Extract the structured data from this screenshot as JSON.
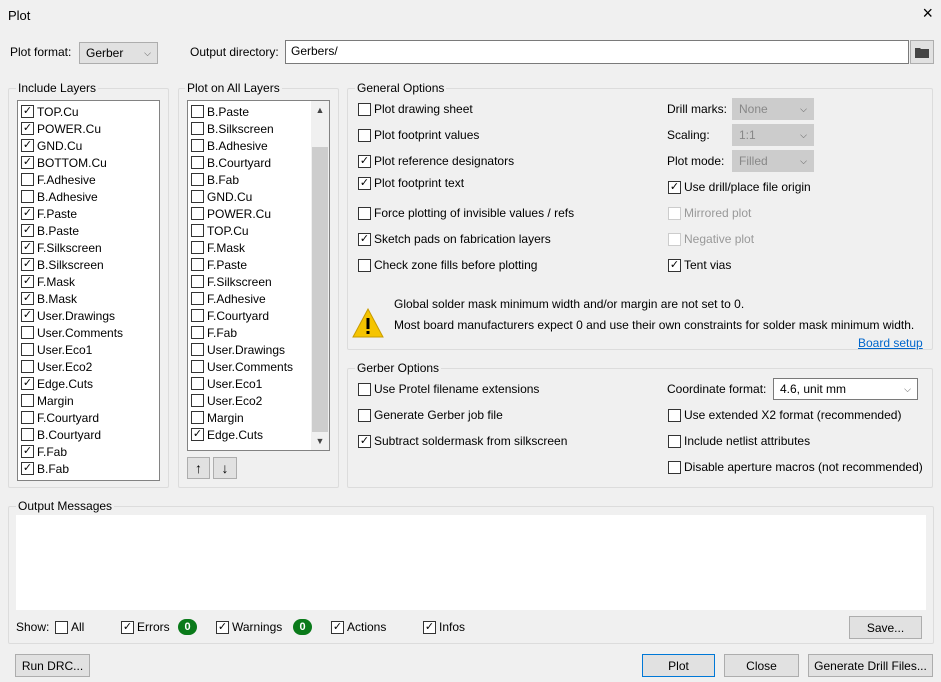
{
  "window": {
    "title": "Plot",
    "close_icon": "×"
  },
  "plot_format": {
    "label": "Plot format:",
    "value": "Gerber"
  },
  "output_dir": {
    "label": "Output directory:",
    "value": "Gerbers/",
    "folder_icon": "folder-icon"
  },
  "include_layers": {
    "title": "Include Layers",
    "items": [
      {
        "label": "TOP.Cu",
        "checked": true
      },
      {
        "label": "POWER.Cu",
        "checked": true
      },
      {
        "label": "GND.Cu",
        "checked": true
      },
      {
        "label": "BOTTOM.Cu",
        "checked": true
      },
      {
        "label": "F.Adhesive",
        "checked": false
      },
      {
        "label": "B.Adhesive",
        "checked": false
      },
      {
        "label": "F.Paste",
        "checked": true
      },
      {
        "label": "B.Paste",
        "checked": true
      },
      {
        "label": "F.Silkscreen",
        "checked": true
      },
      {
        "label": "B.Silkscreen",
        "checked": true
      },
      {
        "label": "F.Mask",
        "checked": true
      },
      {
        "label": "B.Mask",
        "checked": true
      },
      {
        "label": "User.Drawings",
        "checked": true
      },
      {
        "label": "User.Comments",
        "checked": false
      },
      {
        "label": "User.Eco1",
        "checked": false
      },
      {
        "label": "User.Eco2",
        "checked": false
      },
      {
        "label": "Edge.Cuts",
        "checked": true
      },
      {
        "label": "Margin",
        "checked": false
      },
      {
        "label": "F.Courtyard",
        "checked": false
      },
      {
        "label": "B.Courtyard",
        "checked": false
      },
      {
        "label": "F.Fab",
        "checked": true
      },
      {
        "label": "B.Fab",
        "checked": true
      }
    ]
  },
  "plot_all_layers": {
    "title": "Plot on All Layers",
    "items": [
      {
        "label": "B.Paste",
        "checked": false
      },
      {
        "label": "B.Silkscreen",
        "checked": false
      },
      {
        "label": "B.Adhesive",
        "checked": false
      },
      {
        "label": "B.Courtyard",
        "checked": false
      },
      {
        "label": "B.Fab",
        "checked": false
      },
      {
        "label": "GND.Cu",
        "checked": false
      },
      {
        "label": "POWER.Cu",
        "checked": false
      },
      {
        "label": "TOP.Cu",
        "checked": false
      },
      {
        "label": "F.Mask",
        "checked": false
      },
      {
        "label": "F.Paste",
        "checked": false
      },
      {
        "label": "F.Silkscreen",
        "checked": false
      },
      {
        "label": "F.Adhesive",
        "checked": false
      },
      {
        "label": "F.Courtyard",
        "checked": false
      },
      {
        "label": "F.Fab",
        "checked": false
      },
      {
        "label": "User.Drawings",
        "checked": false
      },
      {
        "label": "User.Comments",
        "checked": false
      },
      {
        "label": "User.Eco1",
        "checked": false
      },
      {
        "label": "User.Eco2",
        "checked": false
      },
      {
        "label": "Margin",
        "checked": false
      },
      {
        "label": "Edge.Cuts",
        "checked": true
      }
    ],
    "move_up_icon": "↑",
    "move_down_icon": "↓"
  },
  "general": {
    "title": "General Options",
    "left": [
      {
        "label": "Plot drawing sheet",
        "checked": false
      },
      {
        "label": "Plot footprint values",
        "checked": false
      },
      {
        "label": "Plot reference designators",
        "checked": true
      },
      {
        "label": "Plot footprint text",
        "checked": true
      },
      {
        "label": "Force plotting of invisible values / refs",
        "checked": false
      },
      {
        "label": "Sketch pads on fabrication layers",
        "checked": true
      },
      {
        "label": "Check zone fills before plotting",
        "checked": false
      }
    ],
    "drill_marks": {
      "label": "Drill marks:",
      "value": "None"
    },
    "scaling": {
      "label": "Scaling:",
      "value": "1:1"
    },
    "plot_mode": {
      "label": "Plot mode:",
      "value": "Filled"
    },
    "right": [
      {
        "label": "Use drill/place file origin",
        "checked": true,
        "disabled": false
      },
      {
        "label": "Mirrored plot",
        "checked": false,
        "disabled": true
      },
      {
        "label": "Negative plot",
        "checked": false,
        "disabled": true
      },
      {
        "label": "Tent vias",
        "checked": true,
        "disabled": false
      }
    ],
    "warning": {
      "line1": "Global solder mask minimum width and/or margin are not set to 0.",
      "line2": "Most board manufacturers expect 0 and use their own constraints for solder mask minimum width.",
      "link": "Board setup"
    }
  },
  "gerber": {
    "title": "Gerber Options",
    "left": [
      {
        "label": "Use Protel filename extensions",
        "checked": false
      },
      {
        "label": "Generate Gerber job file",
        "checked": false
      },
      {
        "label": "Subtract soldermask from silkscreen",
        "checked": true
      }
    ],
    "coord": {
      "label": "Coordinate format:",
      "value": "4.6, unit mm"
    },
    "right": [
      {
        "label": "Use extended X2 format (recommended)",
        "checked": false
      },
      {
        "label": "Include netlist attributes",
        "checked": false
      },
      {
        "label": "Disable aperture macros (not recommended)",
        "checked": false
      }
    ]
  },
  "messages": {
    "title": "Output Messages",
    "show_label": "Show:",
    "all": "All",
    "errors": "Errors",
    "errors_count": "0",
    "warnings": "Warnings",
    "warnings_count": "0",
    "actions": "Actions",
    "infos": "Infos",
    "save": "Save..."
  },
  "buttons": {
    "run_drc": "Run DRC...",
    "plot": "Plot",
    "close": "Close",
    "drill": "Generate Drill Files..."
  }
}
